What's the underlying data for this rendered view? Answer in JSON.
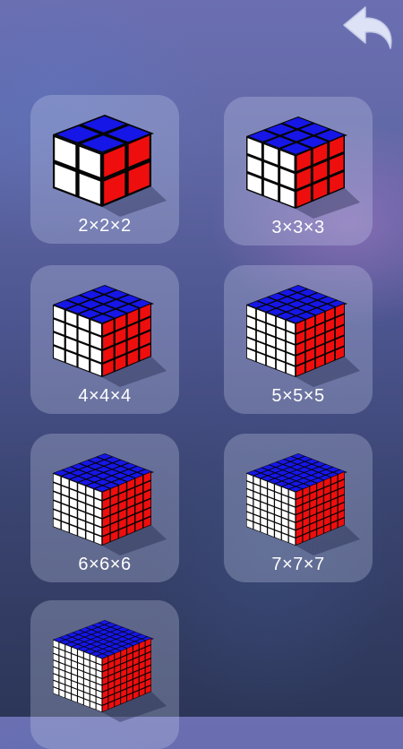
{
  "header": {
    "back_icon": "back-arrow-icon"
  },
  "colors": {
    "top": "#1616e6",
    "left": "#ffffff",
    "right": "#ee0e0e",
    "grid": "#050505"
  },
  "puzzles": [
    {
      "label": "2×2×2",
      "size": 2
    },
    {
      "label": "3×3×3",
      "size": 3
    },
    {
      "label": "4×4×4",
      "size": 4
    },
    {
      "label": "5×5×5",
      "size": 5
    },
    {
      "label": "6×6×6",
      "size": 6
    },
    {
      "label": "7×7×7",
      "size": 7
    },
    {
      "label": "",
      "size": 8
    }
  ]
}
